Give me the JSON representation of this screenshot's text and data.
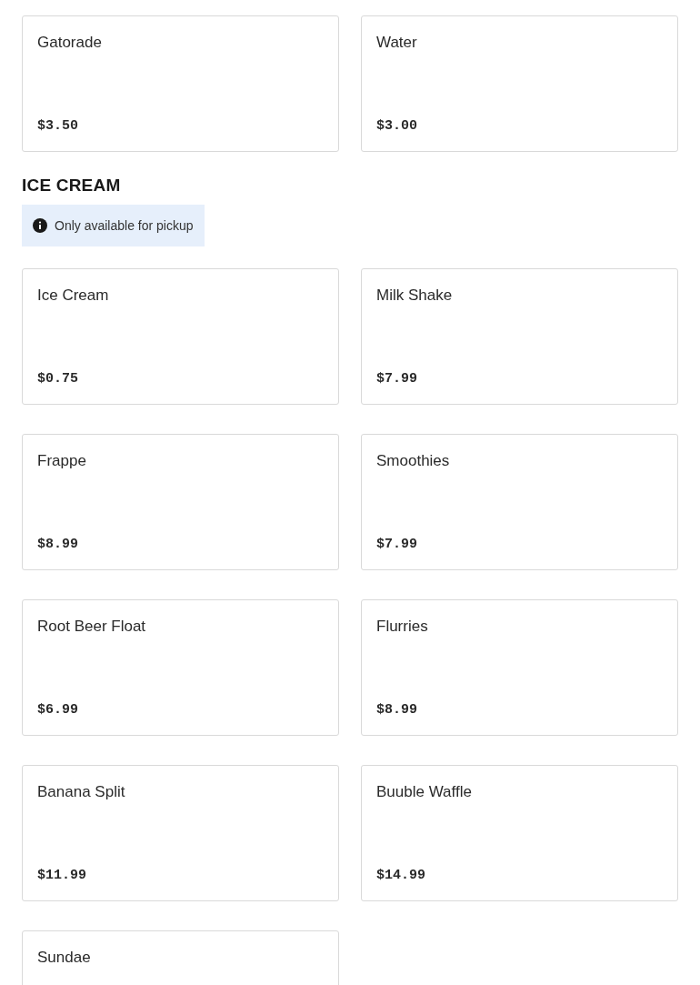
{
  "top_items": [
    {
      "name": "Gatorade",
      "price": "$3.50"
    },
    {
      "name": "Water",
      "price": "$3.00"
    }
  ],
  "section": {
    "title": "ICE CREAM",
    "notice": "Only available for pickup",
    "items": [
      {
        "name": "Ice Cream",
        "price": "$0.75"
      },
      {
        "name": "Milk Shake",
        "price": "$7.99"
      },
      {
        "name": "Frappe",
        "price": "$8.99"
      },
      {
        "name": "Smoothies",
        "price": "$7.99"
      },
      {
        "name": "Root Beer Float",
        "price": "$6.99"
      },
      {
        "name": "Flurries",
        "price": "$8.99"
      },
      {
        "name": "Banana Split",
        "price": "$11.99"
      },
      {
        "name": "Buuble Waffle",
        "price": "$14.99"
      },
      {
        "name": "Sundae"
      }
    ]
  }
}
